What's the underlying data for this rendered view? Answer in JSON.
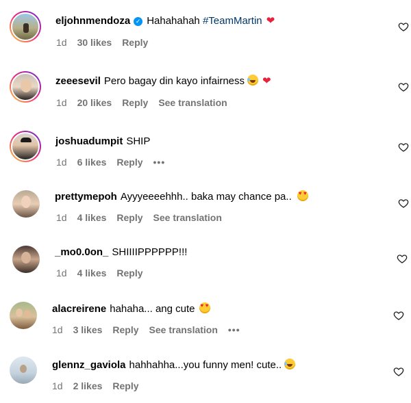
{
  "comments": [
    {
      "username": "eljohnmendoza",
      "verified": true,
      "text": "Hahahahah",
      "hashtag": "#TeamMartin",
      "age": "1d",
      "likes": "30 likes",
      "reply": "Reply"
    },
    {
      "username": "zeeesevil",
      "text": "Pero bagay din kayo infairness",
      "age": "1d",
      "likes": "20 likes",
      "reply": "Reply",
      "translation": "See translation"
    },
    {
      "username": "joshuadumpit",
      "text": "SHIP",
      "age": "1d",
      "likes": "6 likes",
      "reply": "Reply"
    },
    {
      "username": "prettymepoh",
      "text": "Ayyyeeeehhh.. baka may chance pa..",
      "age": "1d",
      "likes": "4 likes",
      "reply": "Reply",
      "translation": "See translation"
    },
    {
      "username": "_mo0.0on_",
      "text": "SHIIIIPPPPPP!!!",
      "age": "1d",
      "likes": "4 likes",
      "reply": "Reply"
    },
    {
      "username": "alacreirene",
      "text": "hahaha... ang cute",
      "age": "1d",
      "likes": "3 likes",
      "reply": "Reply",
      "translation": "See translation"
    },
    {
      "username": "glennz_gaviola",
      "text": "hahhahha...you funny men! cute..",
      "age": "1d",
      "likes": "2 likes",
      "reply": "Reply"
    }
  ],
  "more_options_glyph": "•••",
  "colors": {
    "verified_badge": "#0095f6",
    "hashtag": "#00376b",
    "heart": "#e6233a",
    "meta_text": "#737373"
  },
  "icons": {
    "like": "heart-outline-icon",
    "red_heart": "red-heart-emoji",
    "heart_eyes": "heart-eyes-emoji",
    "tears_of_joy": "tears-of-joy-emoji",
    "verified": "verified-badge-icon"
  }
}
